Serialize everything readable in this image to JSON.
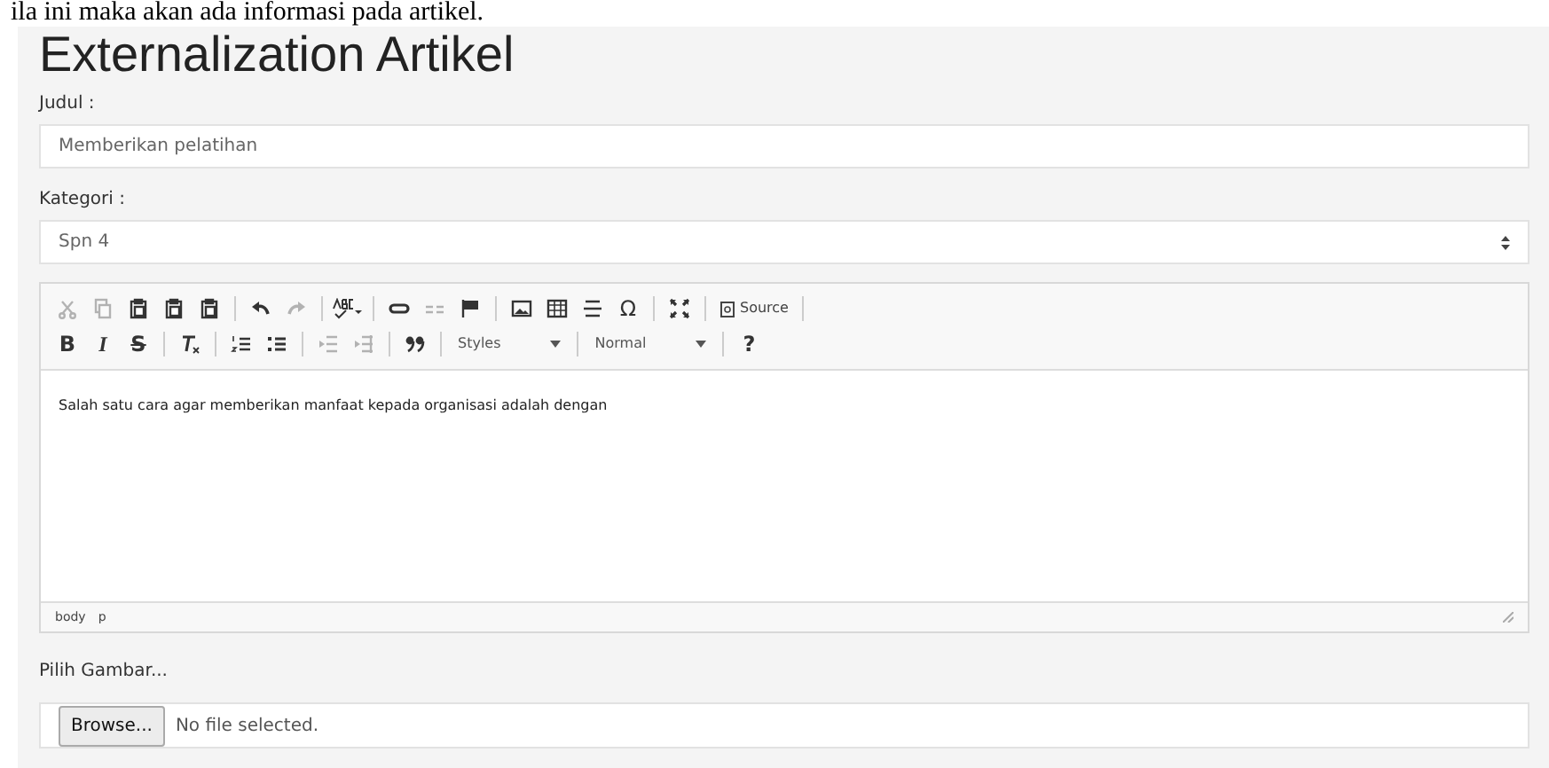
{
  "caption": "ila ini maka akan ada informasi pada artikel.",
  "title": "Externalization Artikel",
  "judul": {
    "label": "Judul :",
    "value": "Memberikan pelatihan"
  },
  "kategori": {
    "label": "Kategori :",
    "value": "Spn 4"
  },
  "editor": {
    "toolbar_rows": [
      [
        {
          "kind": "cut",
          "disabled": true
        },
        {
          "kind": "copy",
          "disabled": true
        },
        {
          "kind": "paste",
          "disabled": false
        },
        {
          "kind": "paste",
          "disabled": false
        },
        {
          "kind": "paste",
          "disabled": false
        },
        {
          "kind": "separator"
        },
        {
          "kind": "undo",
          "disabled": false
        },
        {
          "kind": "redo",
          "disabled": true
        },
        {
          "kind": "separator"
        },
        {
          "kind": "spellcheck",
          "disabled": false
        },
        {
          "kind": "separator"
        },
        {
          "kind": "link",
          "disabled": false
        },
        {
          "kind": "unlink",
          "disabled": true
        },
        {
          "kind": "flag",
          "disabled": false
        },
        {
          "kind": "separator"
        },
        {
          "kind": "image",
          "disabled": false
        },
        {
          "kind": "table",
          "disabled": false
        },
        {
          "kind": "hr",
          "disabled": false
        },
        {
          "kind": "glyph",
          "text": "Ω",
          "disabled": false
        },
        {
          "kind": "separator"
        },
        {
          "kind": "maximize",
          "disabled": false
        },
        {
          "kind": "separator"
        },
        {
          "kind": "source",
          "text": "Source"
        },
        {
          "kind": "separator"
        }
      ],
      [
        {
          "kind": "bold",
          "text": "B",
          "disabled": false
        },
        {
          "kind": "italic",
          "text": "I",
          "disabled": false
        },
        {
          "kind": "strike",
          "text": "S",
          "disabled": false
        },
        {
          "kind": "separator"
        },
        {
          "kind": "clearformat",
          "disabled": false
        },
        {
          "kind": "separator"
        },
        {
          "kind": "numberedlist",
          "disabled": false
        },
        {
          "kind": "bulletlist",
          "disabled": false
        },
        {
          "kind": "separator"
        },
        {
          "kind": "outdent",
          "disabled": true
        },
        {
          "kind": "indent",
          "disabled": true
        },
        {
          "kind": "separator"
        },
        {
          "kind": "quote",
          "disabled": false
        },
        {
          "kind": "separator"
        },
        {
          "kind": "combo",
          "text": "Styles"
        },
        {
          "kind": "separator"
        },
        {
          "kind": "combo",
          "text": "Normal"
        },
        {
          "kind": "separator"
        },
        {
          "kind": "bold",
          "text": "?",
          "disabled": false
        }
      ]
    ],
    "content": "Salah satu cara agar memberikan manfaat kepada organisasi adalah dengan",
    "path": [
      "body",
      "p"
    ]
  },
  "gambar": {
    "label": "Pilih Gambar...",
    "button": "Browse...",
    "status": "No file selected."
  }
}
